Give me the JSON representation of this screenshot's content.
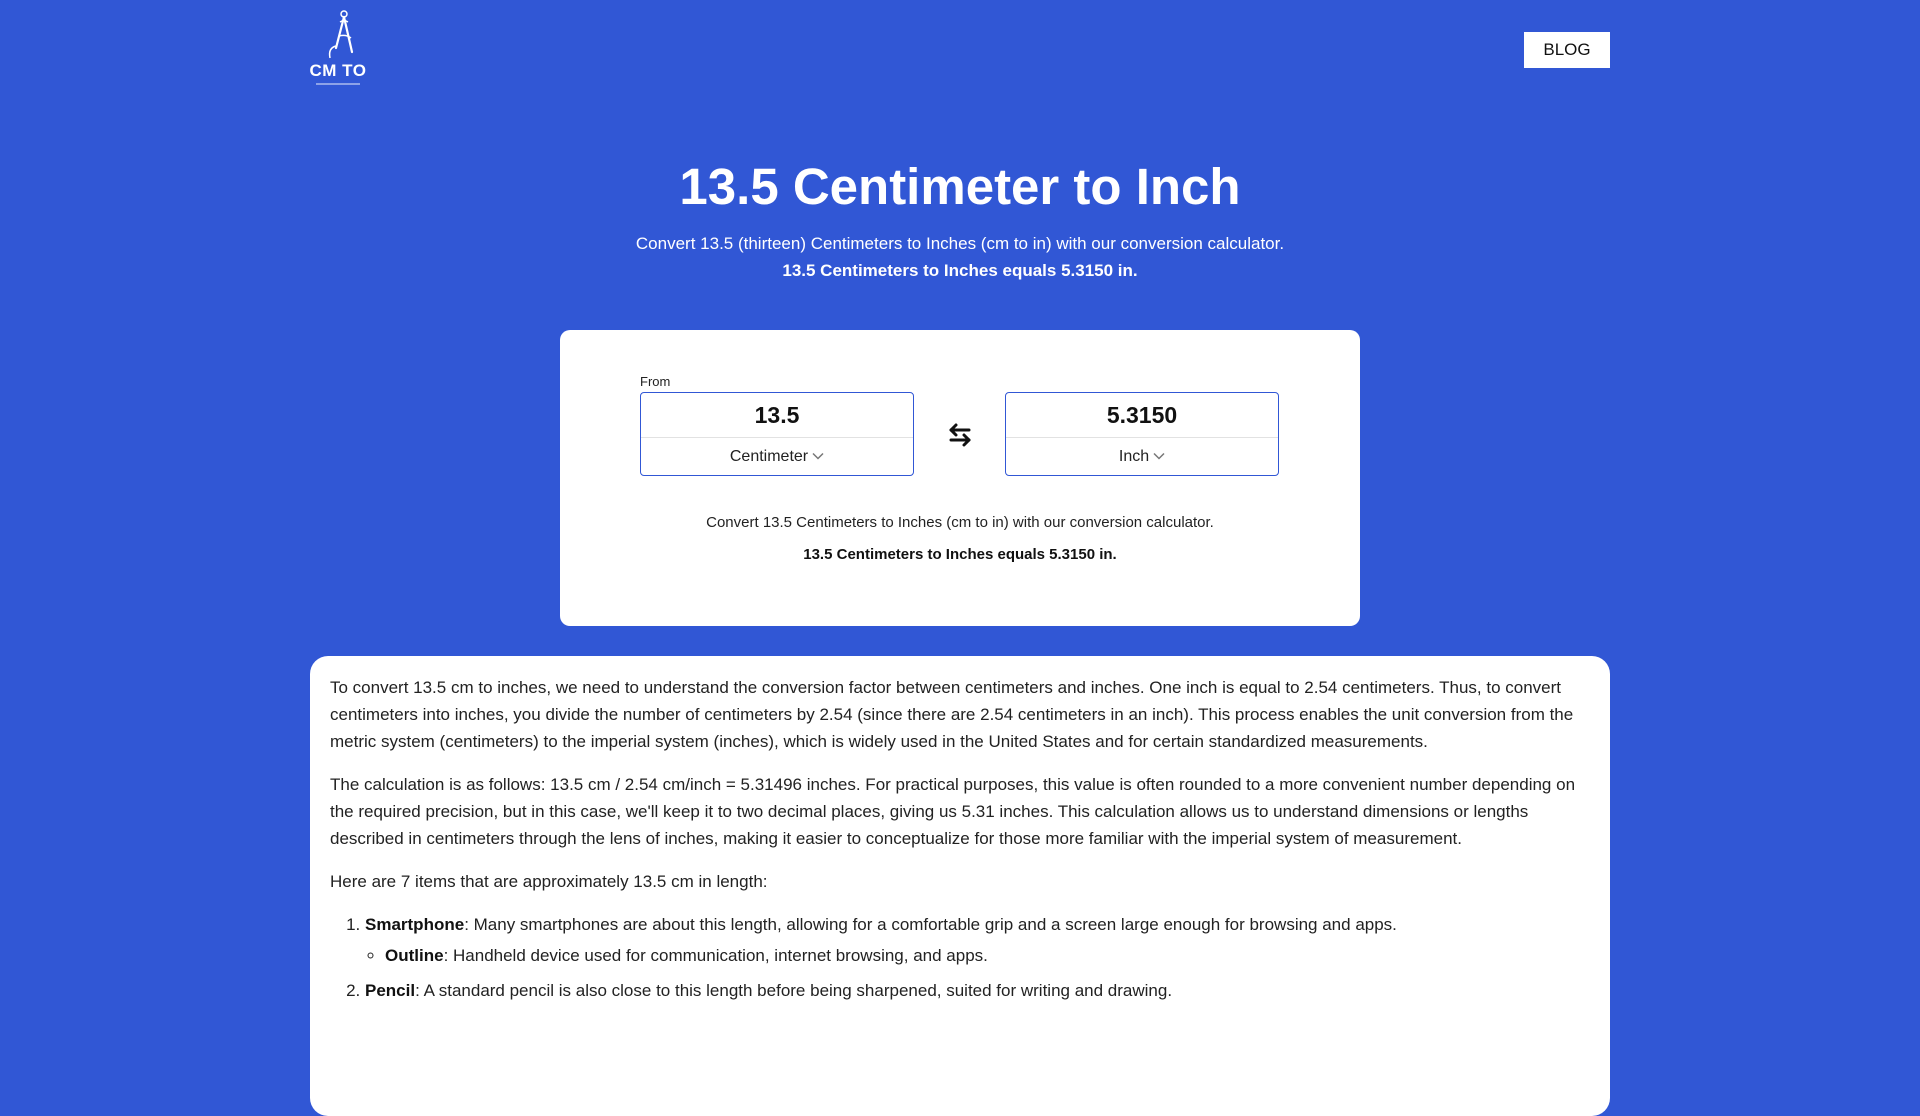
{
  "header": {
    "logo_text": "CM TO",
    "blog_label": "BLOG"
  },
  "hero": {
    "title": "13.5 Centimeter to Inch",
    "subtitle": "Convert 13.5 (thirteen) Centimeters to Inches (cm to in) with our conversion calculator.",
    "result_line": "13.5 Centimeters to Inches equals 5.3150 in."
  },
  "converter": {
    "from_label": "From",
    "from_value": "13.5",
    "from_unit": "Centimeter",
    "to_value": "5.3150",
    "to_unit": "Inch",
    "description": "Convert 13.5 Centimeters to Inches (cm to in) with our conversion calculator.",
    "result_line": "13.5 Centimeters to Inches equals 5.3150 in."
  },
  "article": {
    "paragraphs": [
      "To convert 13.5 cm to inches, we need to understand the conversion factor between centimeters and inches. One inch is equal to 2.54 centimeters. Thus, to convert centimeters into inches, you divide the number of centimeters by 2.54 (since there are 2.54 centimeters in an inch). This process enables the unit conversion from the metric system (centimeters) to the imperial system (inches), which is widely used in the United States and for certain standardized measurements.",
      "The calculation is as follows: 13.5 cm / 2.54 cm/inch = 5.31496 inches. For practical purposes, this value is often rounded to a more convenient number depending on the required precision, but in this case, we'll keep it to two decimal places, giving us 5.31 inches. This calculation allows us to understand dimensions or lengths described in centimeters through the lens of inches, making it easier to conceptualize for those more familiar with the imperial system of measurement.",
      "Here are 7 items that are approximately 13.5 cm in length:"
    ],
    "items": [
      {
        "name": "Smartphone",
        "text": ": Many smartphones are about this length, allowing for a comfortable grip and a screen large enough for browsing and apps.",
        "outline_label": "Outline",
        "outline_text": ": Handheld device used for communication, internet browsing, and apps."
      },
      {
        "name": "Pencil",
        "text": ": A standard pencil is also close to this length before being sharpened, suited for writing and drawing."
      }
    ]
  }
}
